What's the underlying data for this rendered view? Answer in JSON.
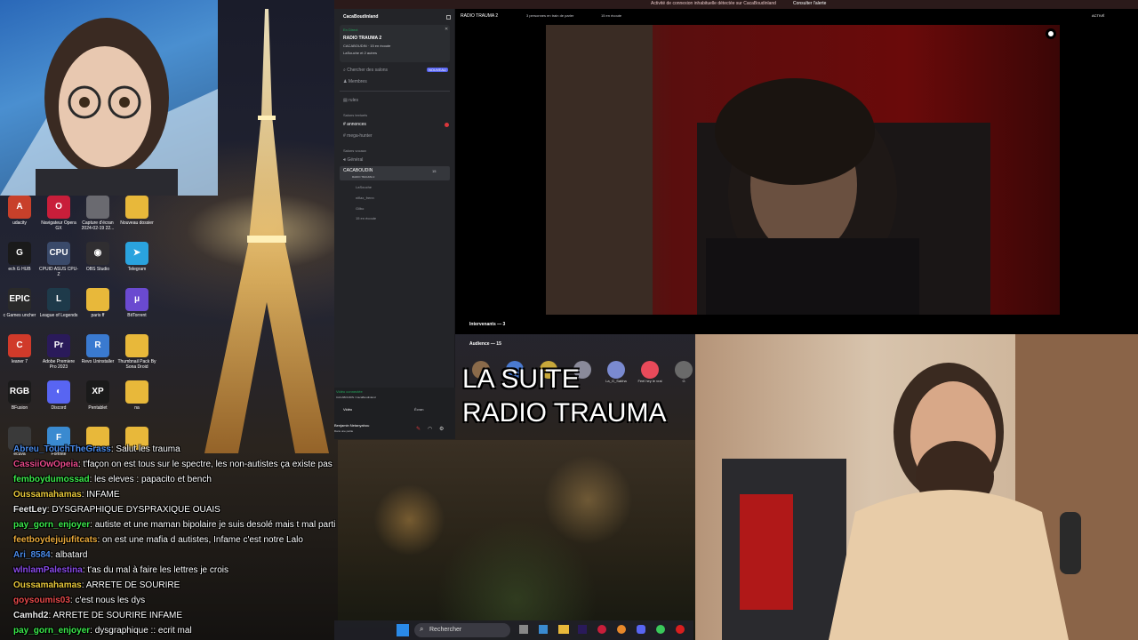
{
  "colors": {
    "discord_bg": "#232428",
    "accent": "#5865f2",
    "live_green": "#23a55a",
    "alert_red": "#da373c"
  },
  "discord": {
    "topbar": {
      "alert": "Activité de connexion inhabituelle détectée sur CacaBoudinland",
      "alert_action": "Consulter l'alerte"
    },
    "server_name": "CacaBoudinland",
    "voice_panel": {
      "status": "En Direct",
      "title": "RADIO TRAUMA 2",
      "sub": "CACABOUDIN · 15 en écoute",
      "members": "LaSouche et 2 autres"
    },
    "nav": [
      {
        "label": "Chercher des salons",
        "badge": "NOUVEAU"
      },
      {
        "label": "Membres"
      }
    ],
    "channels": [
      {
        "icon": "#",
        "label": "rules"
      }
    ],
    "category_text": "Salons textuels",
    "text_channels": [
      {
        "label": "annonces"
      },
      {
        "label": "mega-hunter"
      }
    ],
    "category_voice": "Salons vocaux",
    "voice_channels": [
      {
        "label": "Général"
      }
    ],
    "stage": {
      "label": "CACABOUDIN",
      "sub": "RADIO TRAUMA 2",
      "count": "15",
      "users": [
        "LaSouche",
        "niflax_frenn",
        "Gilbo"
      ],
      "listening": "15 en écoute"
    },
    "connected": {
      "label": "Vidéo connectée",
      "sub": "CACABOUDIN / CacaBoudinland",
      "video": "Vidéo",
      "screen": "Écran"
    },
    "user": {
      "name": "Benjamin Netanyahou",
      "status": "Dans une partie"
    },
    "stage_header": {
      "title": "RADIO TRAUMA 2",
      "info": "3 personnes en train de parler",
      "listen": "15 en écoute",
      "badge": "ACTIVÉ"
    },
    "speakers_label": "Intervenants — 3",
    "audience_label": "Audience — 15",
    "audience": [
      "",
      "",
      "",
      "",
      "La_G_Sabha",
      "Feel hey le vrai",
      "G"
    ]
  },
  "desktop_icons": [
    {
      "label": "udacity",
      "color": "#c8402a",
      "glyph": "A"
    },
    {
      "label": "Navigateur Opera GX",
      "color": "#c81e3a",
      "glyph": "O"
    },
    {
      "label": "Capture d'écran 2024-02-19 22...",
      "color": "#6a6a70",
      "glyph": ""
    },
    {
      "label": "Nouveau dossier",
      "color": "#e8b83a",
      "glyph": ""
    },
    {
      "label": "ech G HUB",
      "color": "#1a1a1a",
      "glyph": "G"
    },
    {
      "label": "CPUID ASUS CPU-Z",
      "color": "#3a4a6a",
      "glyph": "CPU"
    },
    {
      "label": "OBS Studio",
      "color": "#302e31",
      "glyph": "◉"
    },
    {
      "label": "Telegram",
      "color": "#2aa3de",
      "glyph": "➤"
    },
    {
      "label": "c Games uncher",
      "color": "#2a2a2a",
      "glyph": "EPIC"
    },
    {
      "label": "League of Legends",
      "color": "#1e3a4a",
      "glyph": "L"
    },
    {
      "label": "paris ff",
      "color": "#e8b83a",
      "glyph": ""
    },
    {
      "label": "BitTorrent",
      "color": "#6a4ad0",
      "glyph": "μ"
    },
    {
      "label": "leaner 7",
      "color": "#d03a2a",
      "glyph": "C"
    },
    {
      "label": "Adobe Premiere Pro 2023",
      "color": "#2a1a5a",
      "glyph": "Pr"
    },
    {
      "label": "Revo Uninstaller",
      "color": "#3a7ad0",
      "glyph": "R"
    },
    {
      "label": "Thumbnail Pack By Sona Droid",
      "color": "#e8b83a",
      "glyph": ""
    },
    {
      "label": "BFusion",
      "color": "#1a1a1a",
      "glyph": "RGB"
    },
    {
      "label": "Discord",
      "color": "#5865f2",
      "glyph": "◐"
    },
    {
      "label": "Pentablet",
      "color": "#1a1a1a",
      "glyph": "XP"
    },
    {
      "label": "na",
      "color": "#e8b83a",
      "glyph": ""
    },
    {
      "label": "ecuva",
      "color": "#3a3a3a",
      "glyph": ""
    },
    {
      "label": "Fortnite",
      "color": "#3a8ad0",
      "glyph": "F"
    },
    {
      "label": "",
      "color": "#e8b83a",
      "glyph": ""
    },
    {
      "label": "",
      "color": "#e8b83a",
      "glyph": ""
    }
  ],
  "chat": [
    {
      "user": "Abreu_TouchTheGrass",
      "color": "#4a8ae8",
      "text": "Salut les trauma"
    },
    {
      "user": "CassiiOwOpeia",
      "color": "#e84a8a",
      "text": "t'façon on est tous sur le spectre, les non-autistes ça existe pas"
    },
    {
      "user": "femboydumossad",
      "color": "#3ae84a",
      "text": "les eleves : papacito et bench"
    },
    {
      "user": "Oussamahamas",
      "color": "#e8c83a",
      "text": "INFAME"
    },
    {
      "user": "FeetLey",
      "color": "#e8e8e8",
      "text": "DYSGRAPHIQUE DYSPRAXIQUE OUAIS"
    },
    {
      "user": "pay_gorn_enjoyer",
      "color": "#3ae84a",
      "text": "autiste et une maman bipolaire je suis desolé mais t mal parti"
    },
    {
      "user": "feetboydejujufitcats",
      "color": "#e8a83a",
      "text": "on est une mafia d autistes, Infame c'est notre Lalo"
    },
    {
      "user": "Ari_8584",
      "color": "#4a8ae8",
      "text": "albatard"
    },
    {
      "user": "wlnlamPalestina",
      "color": "#8a4ae8",
      "text": "t'as du mal à faire les lettres je crois"
    },
    {
      "user": "Oussamahamas",
      "color": "#e8c83a",
      "text": "ARRETE DE SOURIRE"
    },
    {
      "user": "goysoumis03",
      "color": "#e84a4a",
      "text": "c'est nous les dys"
    },
    {
      "user": "Camhd2",
      "color": "#e8e8e8",
      "text": "ARRETE DE SOURIRE INFAME"
    },
    {
      "user": "pay_gorn_enjoyer",
      "color": "#3ae84a",
      "text": "dysgraphique :: ecrit mal"
    }
  ],
  "overlay": {
    "line1": "LA SUITE",
    "line2": "RADIO TRAUMA"
  },
  "taskbar": {
    "search": "Rechercher"
  }
}
